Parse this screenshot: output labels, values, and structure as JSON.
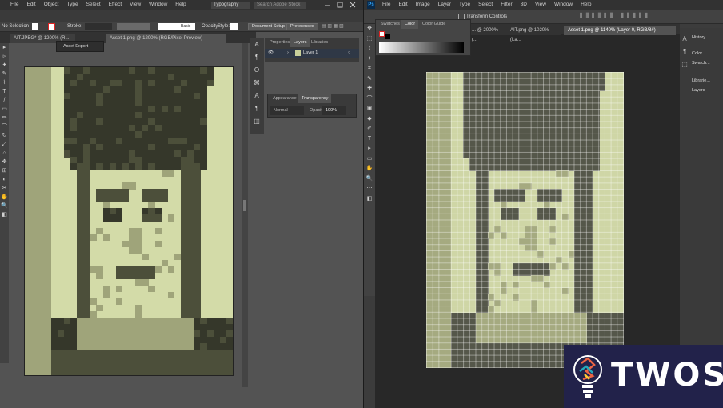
{
  "illustrator": {
    "menu": [
      "File",
      "Edit",
      "Object",
      "Type",
      "Select",
      "Effect",
      "View",
      "Window",
      "Help"
    ],
    "workspace": "Typography",
    "search_placeholder": "Search Adobe Stock",
    "control_bar": {
      "selection": "No Selection",
      "stroke_label": "Stroke:",
      "brush": "Basic",
      "opacity_label": "Opacity",
      "style_label": "Style:",
      "document_setup": "Document Setup",
      "preferences": "Preferences"
    },
    "tabs": [
      "AIT.JPEG* @ 1200% (R...",
      "Asset 1.png @ 1200% (RGB/Pixel Preview)"
    ],
    "asset_export": "Asset Export",
    "panel_tabs": [
      "Properties",
      "Layers",
      "Libraries"
    ],
    "layer_name": "Layer 1",
    "transparency_tabs": [
      "Appearance",
      "Transparency"
    ],
    "blend_mode": "Normal",
    "opacity_label": "Opacity:",
    "opacity_value": "100%"
  },
  "photoshop": {
    "app_icon": "Ps",
    "menu": [
      "File",
      "Edit",
      "Image",
      "Layer",
      "Type",
      "Select",
      "Filter",
      "3D",
      "View",
      "Window",
      "Help"
    ],
    "options": {
      "transform_controls": "Transform Controls"
    },
    "panel_tabs": [
      "Swatches",
      "Color",
      "Color Guide"
    ],
    "tabs": [
      "... @ 2000% (...",
      "AIT.png @ 1020% (La...",
      "Asset 1.png @ 1140% (Layer 0, RGB/8#)"
    ],
    "right_panel": [
      "History",
      "Color",
      "Swatch...",
      "Librarie...",
      "Layers"
    ]
  },
  "colors": {
    "light": "#d3dba8",
    "mid": "#9fa47a",
    "dark": "#4c4f3a",
    "darker": "#35372a",
    "ps_light": "#cfd6a6",
    "ps_mid": "#a5aa80",
    "ps_dark": "#55574a"
  },
  "watermark": {
    "text": "TWOS"
  }
}
